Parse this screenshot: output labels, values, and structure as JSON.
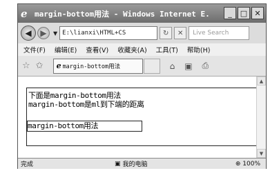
{
  "window": {
    "title": "margin-bottom用法 - Windows Internet E...",
    "min_label": "_",
    "max_label": "□",
    "close_label": "✕"
  },
  "address": {
    "url": "E:\\lianxi\\HTML+CS",
    "search_placeholder": "Live Search"
  },
  "menu": {
    "items": [
      "文件(F)",
      "编辑(E)",
      "查看(V)",
      "收藏夹(A)",
      "工具(T)",
      "帮助(H)"
    ]
  },
  "tab": {
    "title": "margin-bottom用法"
  },
  "content": {
    "line1": "下面是margin-bottom用法",
    "line2": "margin-bottom是ml到下端的距离",
    "inner_box": "margin-bottom用法"
  },
  "status": {
    "text": "完成",
    "zone": "我的电脑",
    "zoom": "100%"
  },
  "colors": {
    "titlebar": "#7a7a7a",
    "content_bg": "#ffffff"
  }
}
